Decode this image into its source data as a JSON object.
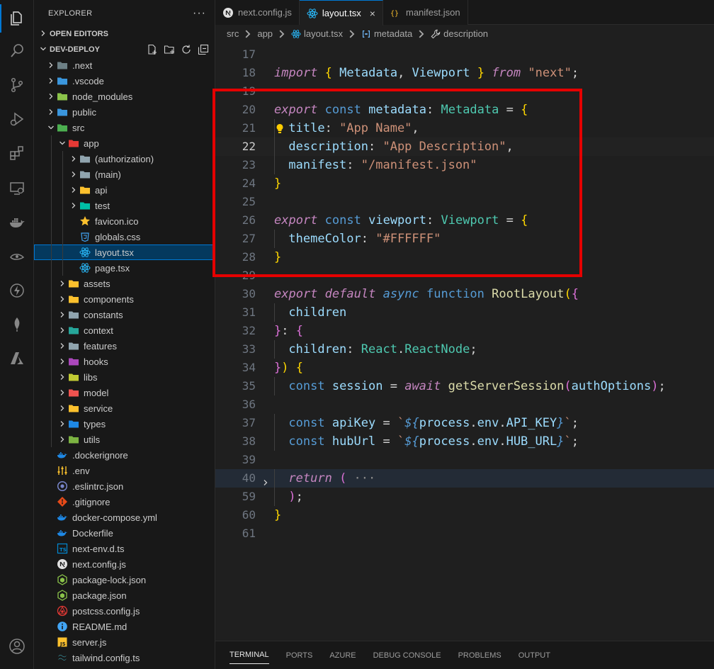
{
  "explorer": {
    "title": "EXPLORER",
    "more": "···",
    "open_editors": "OPEN EDITORS",
    "workspace": "DEV-DEPLOY"
  },
  "tree": [
    {
      "label": ".next",
      "depth": 0,
      "kind": "folder",
      "expanded": false,
      "icon": "next-folder-icon",
      "color": "#6d8086"
    },
    {
      "label": ".vscode",
      "depth": 0,
      "kind": "folder",
      "expanded": false,
      "icon": "vscode-folder-icon",
      "color": "#3a96dd"
    },
    {
      "label": "node_modules",
      "depth": 0,
      "kind": "folder",
      "expanded": false,
      "icon": "node-folder-icon",
      "color": "#8bc34a"
    },
    {
      "label": "public",
      "depth": 0,
      "kind": "folder",
      "expanded": false,
      "icon": "public-folder-icon",
      "color": "#3a96dd"
    },
    {
      "label": "src",
      "depth": 0,
      "kind": "folder",
      "expanded": true,
      "icon": "src-folder-icon",
      "color": "#4caf50"
    },
    {
      "label": "app",
      "depth": 1,
      "kind": "folder",
      "expanded": true,
      "icon": "app-folder-icon",
      "color": "#e53935"
    },
    {
      "label": "(authorization)",
      "depth": 2,
      "kind": "folder",
      "expanded": false,
      "icon": "folder-icon",
      "color": "#90a4ae"
    },
    {
      "label": "(main)",
      "depth": 2,
      "kind": "folder",
      "expanded": false,
      "icon": "folder-icon",
      "color": "#90a4ae"
    },
    {
      "label": "api",
      "depth": 2,
      "kind": "folder",
      "expanded": false,
      "icon": "api-folder-icon",
      "color": "#fbc02d"
    },
    {
      "label": "test",
      "depth": 2,
      "kind": "folder",
      "expanded": false,
      "icon": "test-folder-icon",
      "color": "#00bfa5"
    },
    {
      "label": "favicon.ico",
      "depth": 2,
      "kind": "file",
      "icon": "star-icon",
      "color": "#fbc02d"
    },
    {
      "label": "globals.css",
      "depth": 2,
      "kind": "file",
      "icon": "css-icon",
      "color": "#42a5f5"
    },
    {
      "label": "layout.tsx",
      "depth": 2,
      "kind": "file",
      "icon": "react-icon",
      "color": "#29b6f6",
      "selected": true
    },
    {
      "label": "page.tsx",
      "depth": 2,
      "kind": "file",
      "icon": "react-icon",
      "color": "#29b6f6"
    },
    {
      "label": "assets",
      "depth": 1,
      "kind": "folder",
      "expanded": false,
      "icon": "assets-folder-icon",
      "color": "#fbc02d"
    },
    {
      "label": "components",
      "depth": 1,
      "kind": "folder",
      "expanded": false,
      "icon": "components-folder-icon",
      "color": "#fbc02d"
    },
    {
      "label": "constants",
      "depth": 1,
      "kind": "folder",
      "expanded": false,
      "icon": "constants-folder-icon",
      "color": "#90a4ae"
    },
    {
      "label": "context",
      "depth": 1,
      "kind": "folder",
      "expanded": false,
      "icon": "context-folder-icon",
      "color": "#26a69a"
    },
    {
      "label": "features",
      "depth": 1,
      "kind": "folder",
      "expanded": false,
      "icon": "folder-icon",
      "color": "#90a4ae"
    },
    {
      "label": "hooks",
      "depth": 1,
      "kind": "folder",
      "expanded": false,
      "icon": "hooks-folder-icon",
      "color": "#ab47bc"
    },
    {
      "label": "libs",
      "depth": 1,
      "kind": "folder",
      "expanded": false,
      "icon": "libs-folder-icon",
      "color": "#c0ca33"
    },
    {
      "label": "model",
      "depth": 1,
      "kind": "folder",
      "expanded": false,
      "icon": "model-folder-icon",
      "color": "#ef5350"
    },
    {
      "label": "service",
      "depth": 1,
      "kind": "folder",
      "expanded": false,
      "icon": "service-folder-icon",
      "color": "#fbc02d"
    },
    {
      "label": "types",
      "depth": 1,
      "kind": "folder",
      "expanded": false,
      "icon": "types-folder-icon",
      "color": "#1e88e5"
    },
    {
      "label": "utils",
      "depth": 1,
      "kind": "folder",
      "expanded": false,
      "icon": "utils-folder-icon",
      "color": "#7cb342"
    },
    {
      "label": ".dockerignore",
      "depth": 0,
      "kind": "file",
      "icon": "docker-icon",
      "color": "#1e88e5"
    },
    {
      "label": ".env",
      "depth": 0,
      "kind": "file",
      "icon": "env-icon",
      "color": "#fbc02d"
    },
    {
      "label": ".eslintrc.json",
      "depth": 0,
      "kind": "file",
      "icon": "eslint-icon",
      "color": "#7986cb"
    },
    {
      "label": ".gitignore",
      "depth": 0,
      "kind": "file",
      "icon": "git-icon",
      "color": "#e64a19"
    },
    {
      "label": "docker-compose.yml",
      "depth": 0,
      "kind": "file",
      "icon": "docker-icon",
      "color": "#1e88e5"
    },
    {
      "label": "Dockerfile",
      "depth": 0,
      "kind": "file",
      "icon": "docker-icon",
      "color": "#1e88e5"
    },
    {
      "label": "next-env.d.ts",
      "depth": 0,
      "kind": "file",
      "icon": "ts-icon",
      "color": "#0288d1"
    },
    {
      "label": "next.config.js",
      "depth": 0,
      "kind": "file",
      "icon": "next-icon",
      "color": "#e0e0e0"
    },
    {
      "label": "package-lock.json",
      "depth": 0,
      "kind": "file",
      "icon": "node-icon",
      "color": "#8bc34a"
    },
    {
      "label": "package.json",
      "depth": 0,
      "kind": "file",
      "icon": "node-icon",
      "color": "#8bc34a"
    },
    {
      "label": "postcss.config.js",
      "depth": 0,
      "kind": "file",
      "icon": "postcss-icon",
      "color": "#e53935"
    },
    {
      "label": "README.md",
      "depth": 0,
      "kind": "file",
      "icon": "info-icon",
      "color": "#42a5f5"
    },
    {
      "label": "server.js",
      "depth": 0,
      "kind": "file",
      "icon": "js-icon",
      "color": "#fbc02d"
    },
    {
      "label": "tailwind.config.ts",
      "depth": 0,
      "kind": "file",
      "icon": "tailwind-icon",
      "color": "#4dd0e1"
    }
  ],
  "tabs": [
    {
      "label": "next.config.js",
      "icon": "next-icon",
      "active": false
    },
    {
      "label": "layout.tsx",
      "icon": "react-icon",
      "active": true,
      "close": "×"
    },
    {
      "label": "manifest.json",
      "icon": "json-icon",
      "active": false
    }
  ],
  "breadcrumbs": [
    "src",
    "app",
    "layout.tsx",
    "metadata",
    "description"
  ],
  "code": [
    {
      "n": "17",
      "indent": 0,
      "tokens": []
    },
    {
      "n": "18",
      "indent": 0,
      "tokens": [
        [
          "kw",
          "import"
        ],
        [
          "pu",
          " "
        ],
        [
          "b1",
          "{"
        ],
        [
          "pu",
          " "
        ],
        [
          "vr",
          "Metadata"
        ],
        [
          "pu",
          ", "
        ],
        [
          "vr",
          "Viewport"
        ],
        [
          "pu",
          " "
        ],
        [
          "b1",
          "}"
        ],
        [
          "pu",
          " "
        ],
        [
          "kw",
          "from"
        ],
        [
          "pu",
          " "
        ],
        [
          "st",
          "\"next\""
        ],
        [
          "pu",
          ";"
        ]
      ]
    },
    {
      "n": "19",
      "indent": 0,
      "tokens": []
    },
    {
      "n": "20",
      "indent": 0,
      "tokens": [
        [
          "kw",
          "export"
        ],
        [
          "pu",
          " "
        ],
        [
          "kb",
          "const"
        ],
        [
          "pu",
          " "
        ],
        [
          "vr",
          "metadata"
        ],
        [
          "pu",
          ": "
        ],
        [
          "ty",
          "Metadata"
        ],
        [
          "pu",
          " = "
        ],
        [
          "b1",
          "{"
        ]
      ]
    },
    {
      "n": "21",
      "indent": 1,
      "tokens": [
        [
          "vr",
          "title"
        ],
        [
          "pu",
          ": "
        ],
        [
          "st",
          "\"App Name\""
        ],
        [
          "pu",
          ","
        ]
      ]
    },
    {
      "n": "22",
      "indent": 1,
      "cur": true,
      "tokens": [
        [
          "vr",
          "description"
        ],
        [
          "pu",
          ": "
        ],
        [
          "st",
          "\"App Description\""
        ],
        [
          "pu",
          ","
        ]
      ]
    },
    {
      "n": "23",
      "indent": 1,
      "tokens": [
        [
          "vr",
          "manifest"
        ],
        [
          "pu",
          ": "
        ],
        [
          "st",
          "\"/manifest.json\""
        ]
      ]
    },
    {
      "n": "24",
      "indent": 0,
      "tokens": [
        [
          "b1",
          "}"
        ]
      ]
    },
    {
      "n": "25",
      "indent": 0,
      "tokens": []
    },
    {
      "n": "26",
      "indent": 0,
      "tokens": [
        [
          "kw",
          "export"
        ],
        [
          "pu",
          " "
        ],
        [
          "kb",
          "const"
        ],
        [
          "pu",
          " "
        ],
        [
          "vr",
          "viewport"
        ],
        [
          "pu",
          ": "
        ],
        [
          "ty",
          "Viewport"
        ],
        [
          "pu",
          " = "
        ],
        [
          "b1",
          "{"
        ]
      ]
    },
    {
      "n": "27",
      "indent": 1,
      "tokens": [
        [
          "vr",
          "themeColor"
        ],
        [
          "pu",
          ": "
        ],
        [
          "st",
          "\"#FFFFFF\""
        ]
      ]
    },
    {
      "n": "28",
      "indent": 0,
      "tokens": [
        [
          "b1",
          "}"
        ]
      ]
    },
    {
      "n": "29",
      "indent": 0,
      "tokens": []
    },
    {
      "n": "30",
      "indent": 0,
      "tokens": [
        [
          "kw",
          "export"
        ],
        [
          "pu",
          " "
        ],
        [
          "kw",
          "default"
        ],
        [
          "pu",
          " "
        ],
        [
          "kbi",
          "async"
        ],
        [
          "pu",
          " "
        ],
        [
          "kb",
          "function"
        ],
        [
          "pu",
          " "
        ],
        [
          "fn",
          "RootLayout"
        ],
        [
          "b1",
          "("
        ],
        [
          "b2",
          "{"
        ]
      ]
    },
    {
      "n": "31",
      "indent": 1,
      "tokens": [
        [
          "vr",
          "children"
        ]
      ]
    },
    {
      "n": "32",
      "indent": 0,
      "tokens": [
        [
          "b2",
          "}"
        ],
        [
          "pu",
          ": "
        ],
        [
          "b2",
          "{"
        ]
      ]
    },
    {
      "n": "33",
      "indent": 1,
      "tokens": [
        [
          "vr",
          "children"
        ],
        [
          "pu",
          ": "
        ],
        [
          "ty",
          "React"
        ],
        [
          "pu",
          "."
        ],
        [
          "ty",
          "ReactNode"
        ],
        [
          "pu",
          ";"
        ]
      ]
    },
    {
      "n": "34",
      "indent": 0,
      "tokens": [
        [
          "b2",
          "}"
        ],
        [
          "b1",
          ")"
        ],
        [
          "pu",
          " "
        ],
        [
          "b1",
          "{"
        ]
      ]
    },
    {
      "n": "35",
      "indent": 1,
      "tokens": [
        [
          "kb",
          "const"
        ],
        [
          "pu",
          " "
        ],
        [
          "vr",
          "session"
        ],
        [
          "pu",
          " = "
        ],
        [
          "kw",
          "await"
        ],
        [
          "pu",
          " "
        ],
        [
          "fn",
          "getServerSession"
        ],
        [
          "b2",
          "("
        ],
        [
          "vr",
          "authOptions"
        ],
        [
          "b2",
          ")"
        ],
        [
          "pu",
          ";"
        ]
      ]
    },
    {
      "n": "36",
      "indent": 0,
      "tokens": []
    },
    {
      "n": "37",
      "indent": 1,
      "tokens": [
        [
          "kb",
          "const"
        ],
        [
          "pu",
          " "
        ],
        [
          "vr",
          "apiKey"
        ],
        [
          "pu",
          " = "
        ],
        [
          "st",
          "`"
        ],
        [
          "kbi",
          "${"
        ],
        [
          "vr",
          "process"
        ],
        [
          "pu",
          "."
        ],
        [
          "vr",
          "env"
        ],
        [
          "pu",
          "."
        ],
        [
          "vr",
          "API_KEY"
        ],
        [
          "kbi",
          "}"
        ],
        [
          "st",
          "`"
        ],
        [
          "pu",
          ";"
        ]
      ]
    },
    {
      "n": "38",
      "indent": 1,
      "tokens": [
        [
          "kb",
          "const"
        ],
        [
          "pu",
          " "
        ],
        [
          "vr",
          "hubUrl"
        ],
        [
          "pu",
          " = "
        ],
        [
          "st",
          "`"
        ],
        [
          "kbi",
          "${"
        ],
        [
          "vr",
          "process"
        ],
        [
          "pu",
          "."
        ],
        [
          "vr",
          "env"
        ],
        [
          "pu",
          "."
        ],
        [
          "vr",
          "HUB_URL"
        ],
        [
          "kbi",
          "}"
        ],
        [
          "st",
          "`"
        ],
        [
          "pu",
          ";"
        ]
      ]
    },
    {
      "n": "39",
      "indent": 0,
      "tokens": []
    },
    {
      "n": "40",
      "indent": 1,
      "fold": true,
      "tokens": [
        [
          "kw",
          "return"
        ],
        [
          "pu",
          " "
        ],
        [
          "b2",
          "("
        ],
        [
          "ell",
          " ···"
        ]
      ]
    },
    {
      "n": "59",
      "indent": 1,
      "tokens": [
        [
          "b2",
          ")"
        ],
        [
          "pu",
          ";"
        ]
      ]
    },
    {
      "n": "60",
      "indent": 0,
      "tokens": [
        [
          "b1",
          "}"
        ]
      ]
    },
    {
      "n": "61",
      "indent": 0,
      "tokens": []
    }
  ],
  "panel_tabs": [
    {
      "label": "TERMINAL",
      "active": true
    },
    {
      "label": "PORTS",
      "active": false
    },
    {
      "label": "AZURE",
      "active": false
    },
    {
      "label": "DEBUG CONSOLE",
      "active": false
    },
    {
      "label": "PROBLEMS",
      "active": false
    },
    {
      "label": "OUTPUT",
      "active": false
    }
  ],
  "colors": {
    "accent": "#0078d4",
    "highlight_box": "#e50000",
    "lightbulb": "#ffcc00"
  }
}
